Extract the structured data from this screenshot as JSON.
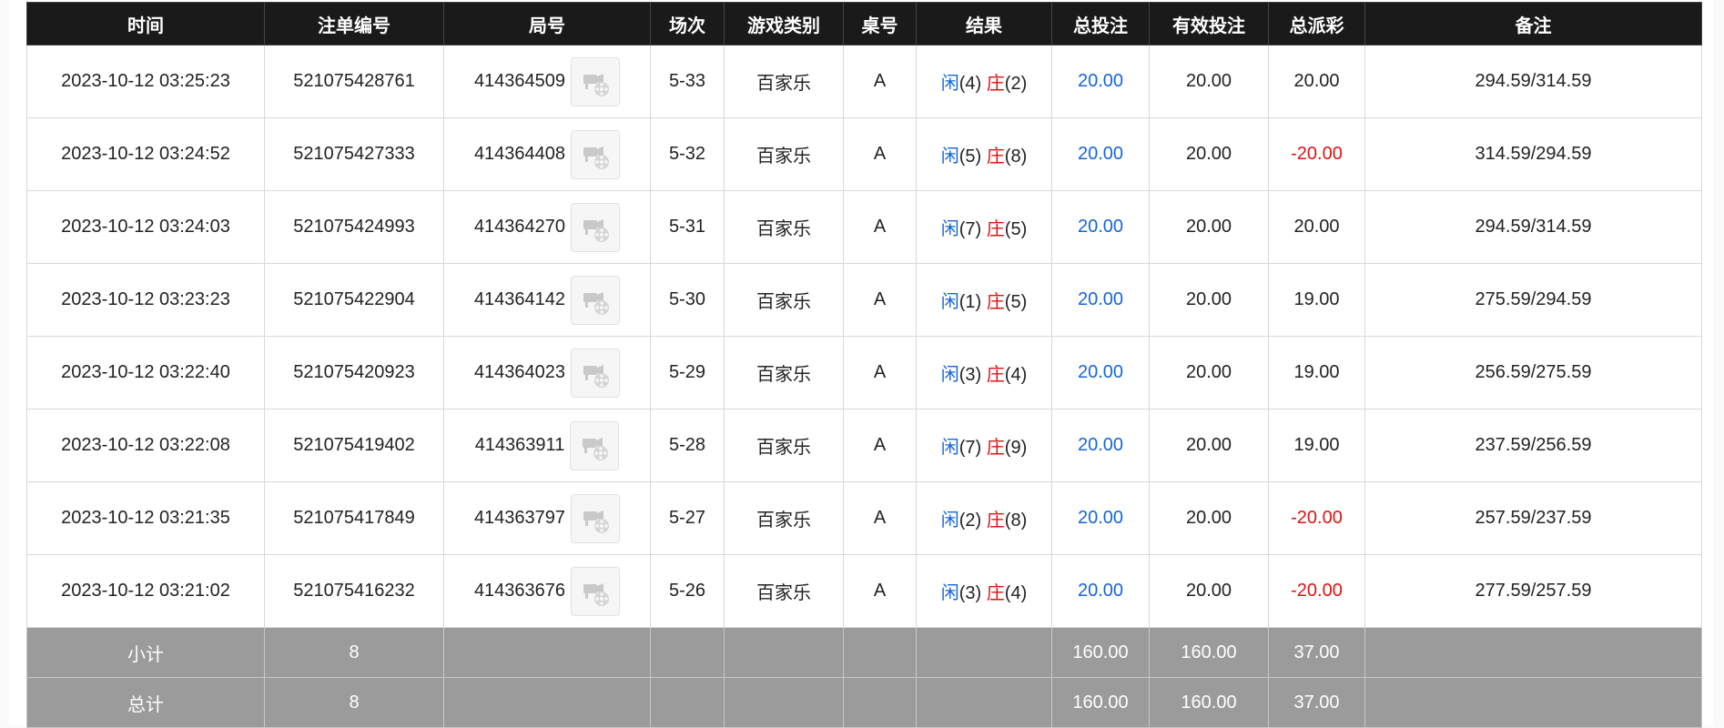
{
  "headers": [
    "时间",
    "注单编号",
    "局号",
    "场次",
    "游戏类别",
    "桌号",
    "结果",
    "总投注",
    "有效投注",
    "总派彩",
    "备注"
  ],
  "result_labels": {
    "player": "闲",
    "banker": "庄"
  },
  "colors": {
    "header_bg": "#1a1a1a",
    "total_bg": "#9b9b9b",
    "blue": "#1565e0",
    "red": "#e01212"
  },
  "rows": [
    {
      "time": "2023-10-12 03:25:23",
      "bet_id": "521075428761",
      "round_no": "414364509",
      "session": "5-33",
      "game": "百家乐",
      "table": "A",
      "player": "(4)",
      "banker": "(2)",
      "total_bet": "20.00",
      "valid_bet": "20.00",
      "payout": "20.00",
      "payout_negative": false,
      "remark": "294.59/314.59"
    },
    {
      "time": "2023-10-12 03:24:52",
      "bet_id": "521075427333",
      "round_no": "414364408",
      "session": "5-32",
      "game": "百家乐",
      "table": "A",
      "player": "(5)",
      "banker": "(8)",
      "total_bet": "20.00",
      "valid_bet": "20.00",
      "payout": "-20.00",
      "payout_negative": true,
      "remark": "314.59/294.59"
    },
    {
      "time": "2023-10-12 03:24:03",
      "bet_id": "521075424993",
      "round_no": "414364270",
      "session": "5-31",
      "game": "百家乐",
      "table": "A",
      "player": "(7)",
      "banker": "(5)",
      "total_bet": "20.00",
      "valid_bet": "20.00",
      "payout": "20.00",
      "payout_negative": false,
      "remark": "294.59/314.59"
    },
    {
      "time": "2023-10-12 03:23:23",
      "bet_id": "521075422904",
      "round_no": "414364142",
      "session": "5-30",
      "game": "百家乐",
      "table": "A",
      "player": "(1)",
      "banker": "(5)",
      "total_bet": "20.00",
      "valid_bet": "20.00",
      "payout": "19.00",
      "payout_negative": false,
      "remark": "275.59/294.59"
    },
    {
      "time": "2023-10-12 03:22:40",
      "bet_id": "521075420923",
      "round_no": "414364023",
      "session": "5-29",
      "game": "百家乐",
      "table": "A",
      "player": "(3)",
      "banker": "(4)",
      "total_bet": "20.00",
      "valid_bet": "20.00",
      "payout": "19.00",
      "payout_negative": false,
      "remark": "256.59/275.59"
    },
    {
      "time": "2023-10-12 03:22:08",
      "bet_id": "521075419402",
      "round_no": "414363911",
      "session": "5-28",
      "game": "百家乐",
      "table": "A",
      "player": "(7)",
      "banker": "(9)",
      "total_bet": "20.00",
      "valid_bet": "20.00",
      "payout": "19.00",
      "payout_negative": false,
      "remark": "237.59/256.59"
    },
    {
      "time": "2023-10-12 03:21:35",
      "bet_id": "521075417849",
      "round_no": "414363797",
      "session": "5-27",
      "game": "百家乐",
      "table": "A",
      "player": "(2)",
      "banker": "(8)",
      "total_bet": "20.00",
      "valid_bet": "20.00",
      "payout": "-20.00",
      "payout_negative": true,
      "remark": "257.59/237.59"
    },
    {
      "time": "2023-10-12 03:21:02",
      "bet_id": "521075416232",
      "round_no": "414363676",
      "session": "5-26",
      "game": "百家乐",
      "table": "A",
      "player": "(3)",
      "banker": "(4)",
      "total_bet": "20.00",
      "valid_bet": "20.00",
      "payout": "-20.00",
      "payout_negative": true,
      "remark": "277.59/257.59"
    }
  ],
  "subtotal": {
    "label": "小计",
    "count": "8",
    "total_bet": "160.00",
    "valid_bet": "160.00",
    "payout": "37.00"
  },
  "grand_total": {
    "label": "总计",
    "count": "8",
    "total_bet": "160.00",
    "valid_bet": "160.00",
    "payout": "37.00"
  },
  "video_icon": "video-replay-icon"
}
